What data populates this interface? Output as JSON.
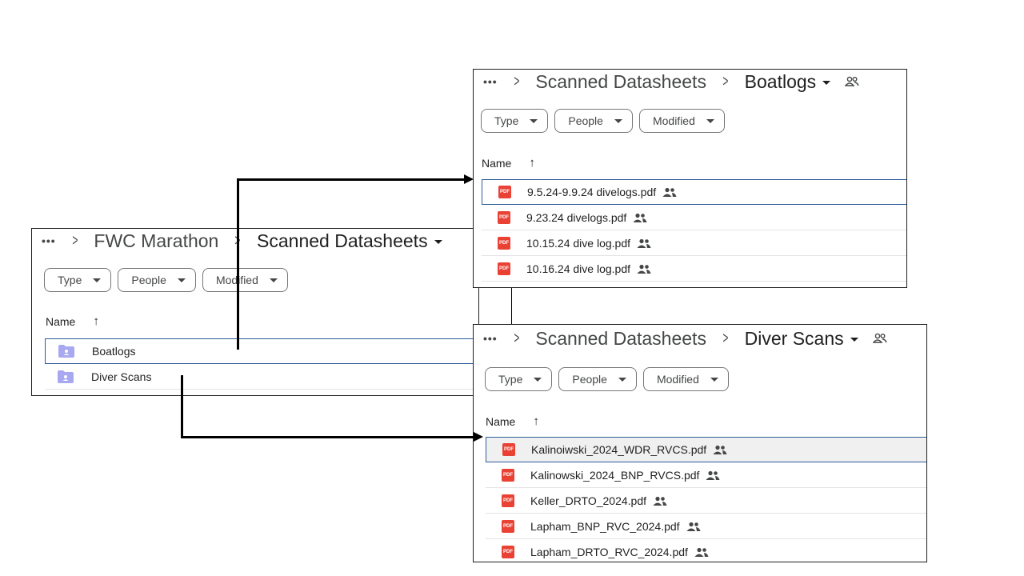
{
  "left_panel": {
    "breadcrumb": [
      "FWC Marathon",
      "Scanned Datasheets"
    ],
    "filters": [
      "Type",
      "People",
      "Modified"
    ],
    "name_header": "Name",
    "sort_arrow": "↑",
    "rows": [
      {
        "name": "Boatlogs",
        "icon": "shared-folder-icon"
      },
      {
        "name": "Diver Scans",
        "icon": "shared-folder-icon"
      }
    ]
  },
  "boatlogs_panel": {
    "breadcrumb": [
      "Scanned Datasheets",
      "Boatlogs"
    ],
    "filters": [
      "Type",
      "People",
      "Modified"
    ],
    "name_header": "Name",
    "sort_arrow": "↑",
    "rows": [
      {
        "name": "9.5.24-9.9.24 divelogs.pdf"
      },
      {
        "name": "9.23.24 divelogs.pdf"
      },
      {
        "name": "10.15.24 dive log.pdf"
      },
      {
        "name": "10.16.24 dive log.pdf"
      }
    ]
  },
  "diver_panel": {
    "breadcrumb": [
      "Scanned Datasheets",
      "Diver Scans"
    ],
    "filters": [
      "Type",
      "People",
      "Modified"
    ],
    "name_header": "Name",
    "sort_arrow": "↑",
    "rows": [
      {
        "name": "Kalinoiwski_2024_WDR_RVCS.pdf"
      },
      {
        "name": "Kalinowski_2024_BNP_RVCS.pdf"
      },
      {
        "name": "Keller_DRTO_2024.pdf"
      },
      {
        "name": "Lapham_BNP_RVC_2024.pdf"
      },
      {
        "name": "Lapham_DRTO_RVC_2024.pdf"
      }
    ]
  },
  "icons": {
    "more": "more-horizontal-icon",
    "separator": "chevron-right-icon",
    "shared": "people-icon",
    "file": "pdf-icon",
    "pdf_label": "PDF"
  },
  "colors": {
    "selection_border": "#2c5b9a",
    "pdf_red": "#e94235",
    "folder_purple": "#a8a8f0",
    "arrow": "#000000"
  }
}
